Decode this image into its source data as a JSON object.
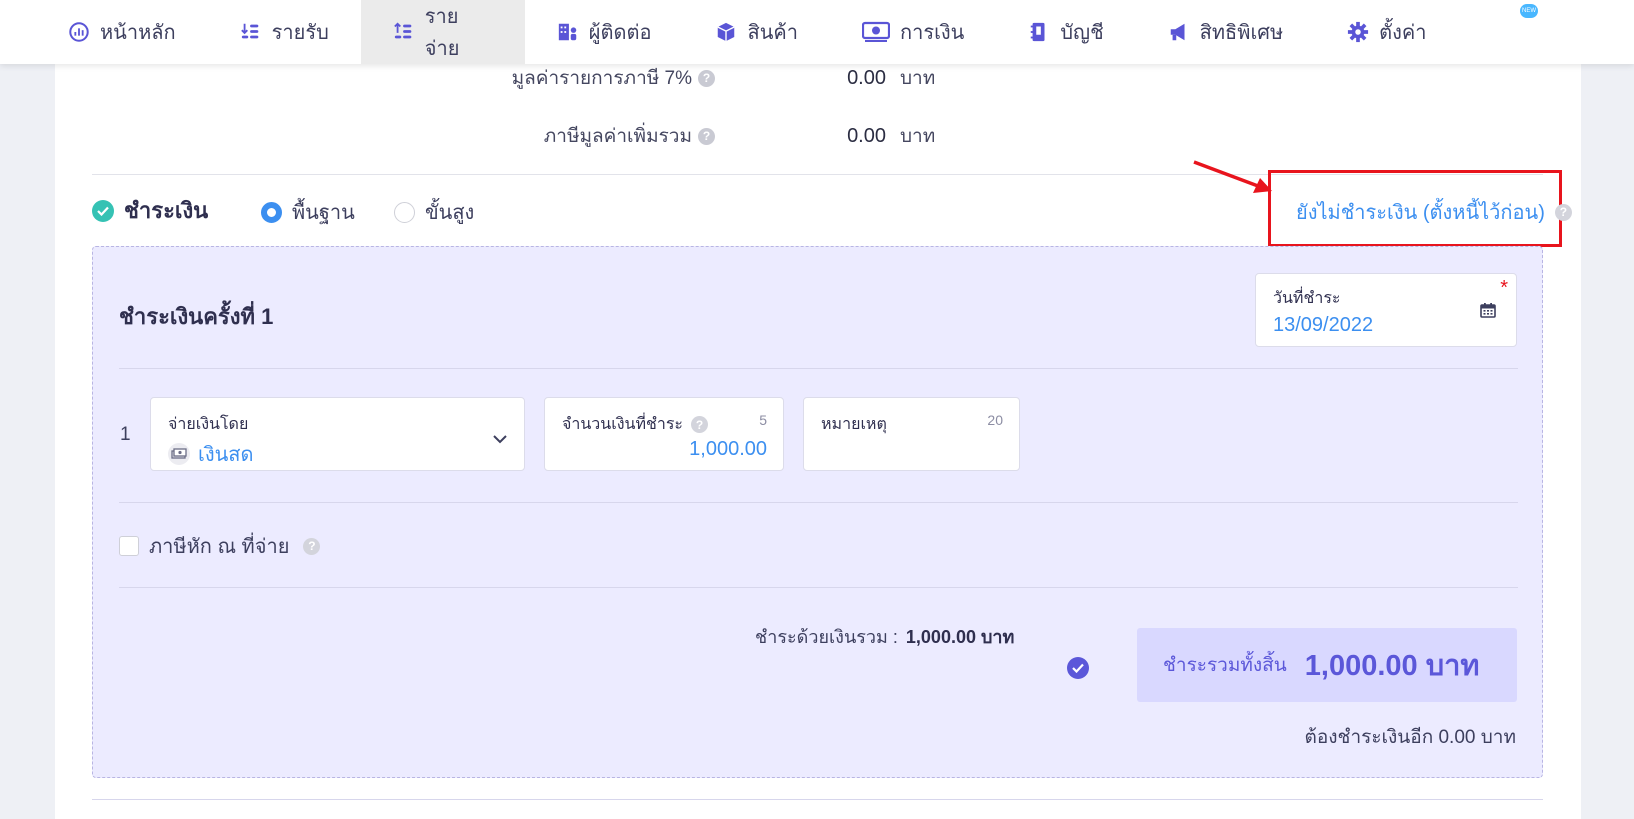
{
  "nav": {
    "items": [
      {
        "label": "หน้าหลัก",
        "icon": "dashboard-icon"
      },
      {
        "label": "รายรับ",
        "icon": "income-icon"
      },
      {
        "label": "รายจ่าย",
        "icon": "expense-icon",
        "active": true
      },
      {
        "label": "ผู้ติดต่อ",
        "icon": "contacts-icon"
      },
      {
        "label": "สินค้า",
        "icon": "product-box-icon"
      },
      {
        "label": "การเงิน",
        "icon": "money-icon"
      },
      {
        "label": "บัญชี",
        "icon": "book-icon"
      },
      {
        "label": "สิทธิพิเศษ",
        "icon": "megaphone-icon"
      },
      {
        "label": "ตั้งค่า",
        "icon": "gear-icon",
        "badge": "NEW"
      }
    ]
  },
  "vat": {
    "rate_label": "มูลค่ารายการภาษี 7%",
    "rate_value": "0.00",
    "total_label": "ภาษีมูลค่าเพิ่มรวม",
    "total_value": "0.00",
    "unit": "บาท"
  },
  "payment": {
    "title": "ชำระเงิน",
    "mode_basic": "พื้นฐาน",
    "mode_advanced": "ขั้นสูง",
    "unpaid_link": "ยังไม่ชำระเงิน (ตั้งหนี้ไว้ก่อน)",
    "installment_title": "ชำระเงินครั้งที่ 1",
    "date_label": "วันที่ชำระ",
    "date_value": "13/09/2022",
    "required_mark": "*",
    "row_number": "1",
    "method_label": "จ่ายเงินโดย",
    "method_value": "เงินสด",
    "amount_label": "จำนวนเงินที่ชำระ",
    "amount_counter": "5",
    "amount_value": "1,000.00",
    "note_label": "หมายเหตุ",
    "note_counter": "20",
    "withholding_label": "ภาษีหัก ณ ที่จ่าย",
    "sum_label": "ชำระด้วยเงินรวม :",
    "sum_value": "1,000.00 บาท",
    "grand_total_label": "ชำระรวมทั้งสิ้น",
    "grand_total_value": "1,000.00 บาท",
    "remaining": "ต้องชำระเงินอีก 0.00 บาท"
  },
  "colors": {
    "accent": "#5b57d9",
    "link": "#3c8ff0",
    "panel_bg": "#ecebff",
    "highlight_red": "#e8141d",
    "check_teal": "#35c2b4"
  }
}
